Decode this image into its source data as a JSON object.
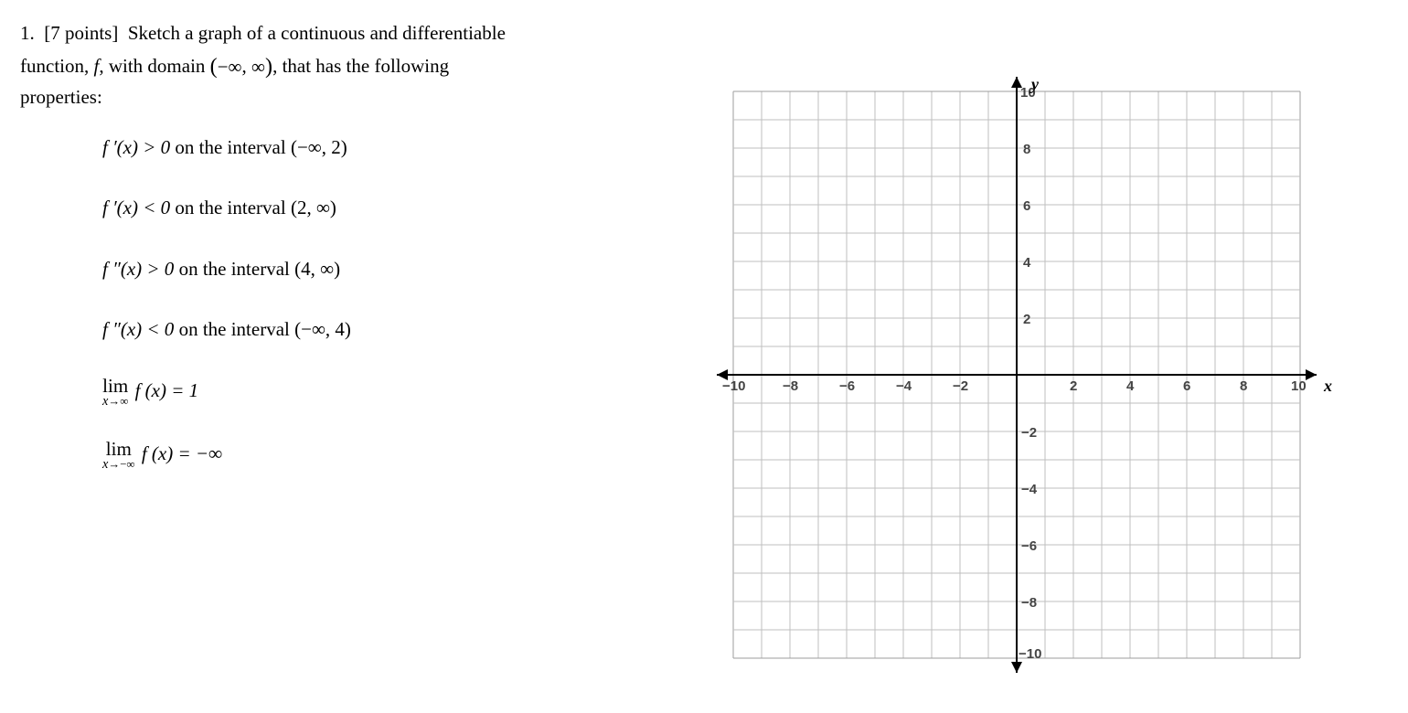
{
  "problem": {
    "number": "1.",
    "points_label": "[7 points]",
    "intro_line1_a": "Sketch a graph of a continuous and differentiable",
    "intro_line2_a": "function, ",
    "intro_line2_func": "f",
    "intro_line2_b": ", with domain ",
    "intro_domain_open": "(",
    "intro_domain_neg": "−∞",
    "intro_domain_comma": ", ",
    "intro_domain_pos": "∞",
    "intro_domain_close": ")",
    "intro_line2_c": ", that has the following",
    "intro_line3": "properties:"
  },
  "items": {
    "p1": {
      "lhs": "f ′(x) > 0",
      "mid": " on the interval ",
      "int": "(−∞, 2)"
    },
    "p2": {
      "lhs": "f ′(x) < 0",
      "mid": " on the interval ",
      "int": "(2, ∞)"
    },
    "p3": {
      "lhs": "f ″(x) > 0",
      "mid": " on the interval ",
      "int": "(4, ∞)"
    },
    "p4": {
      "lhs": "f ″(x) < 0",
      "mid": " on the interval ",
      "int": "(−∞, 4)"
    },
    "p5": {
      "top": "lim",
      "bot": "x→∞",
      "rhs": "f (x) = 1"
    },
    "p6": {
      "top": "lim",
      "bot": "x→−∞",
      "rhs": "f (x) = −∞"
    }
  },
  "chart_data": {
    "type": "scatter",
    "title": "",
    "xlabel": "x",
    "ylabel": "y",
    "xlim": [
      -10,
      10
    ],
    "ylim": [
      -10,
      10
    ],
    "x_ticks": [
      -10,
      -8,
      -6,
      -4,
      -2,
      2,
      4,
      6,
      8,
      10
    ],
    "y_ticks": [
      -10,
      -8,
      -6,
      -4,
      -2,
      2,
      4,
      6,
      8,
      10
    ],
    "grid_step": 1,
    "series": []
  },
  "axis": {
    "x_neg10": "−10",
    "x_neg8": "−8",
    "x_neg6": "−6",
    "x_neg4": "−4",
    "x_neg2": "−2",
    "x_2": "2",
    "x_4": "4",
    "x_6": "6",
    "x_8": "8",
    "x_10": "10",
    "y_neg10": "−10",
    "y_neg8": "−8",
    "y_neg6": "−6",
    "y_neg4": "−4",
    "y_neg2": "−2",
    "y_2": "2",
    "y_4": "4",
    "y_6": "6",
    "y_8": "8",
    "y_10": "10",
    "xlabel": "x",
    "ylabel": "y"
  }
}
